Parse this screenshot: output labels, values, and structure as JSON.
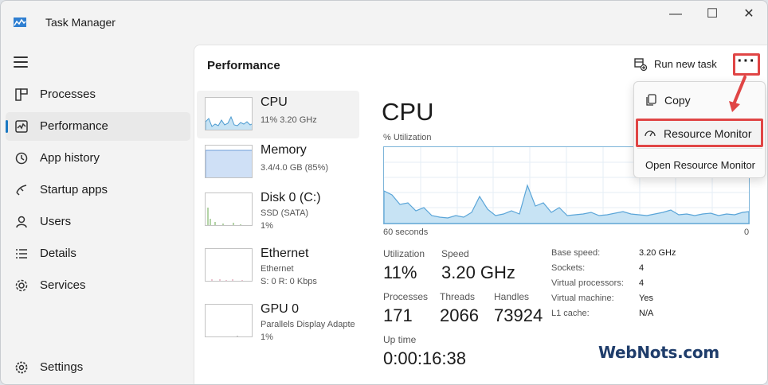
{
  "window": {
    "title": "Task Manager",
    "minimize": "—",
    "maximize": "☐",
    "close": "✕"
  },
  "sidebar": {
    "items": [
      {
        "label": "Processes",
        "icon": "processes-icon"
      },
      {
        "label": "Performance",
        "icon": "performance-icon"
      },
      {
        "label": "App history",
        "icon": "history-icon"
      },
      {
        "label": "Startup apps",
        "icon": "startup-icon"
      },
      {
        "label": "Users",
        "icon": "users-icon"
      },
      {
        "label": "Details",
        "icon": "details-icon"
      },
      {
        "label": "Services",
        "icon": "services-icon"
      }
    ],
    "settings": "Settings",
    "active_index": 1
  },
  "header": {
    "title": "Performance",
    "run_task": "Run new task",
    "more": "···"
  },
  "devices": [
    {
      "name": "CPU",
      "sub1": "11%  3.20 GHz",
      "sub2": ""
    },
    {
      "name": "Memory",
      "sub1": "3.4/4.0 GB (85%)",
      "sub2": ""
    },
    {
      "name": "Disk 0 (C:)",
      "sub1": "SSD (SATA)",
      "sub2": "1%"
    },
    {
      "name": "Ethernet",
      "sub1": "Ethernet",
      "sub2": "S: 0  R: 0 Kbps"
    },
    {
      "name": "GPU 0",
      "sub1": "Parallels Display Adapte",
      "sub2": "1%"
    }
  ],
  "cpu": {
    "title": "CPU",
    "util_label": "% Utilization",
    "axis_left": "60 seconds",
    "axis_right": "0",
    "utilization_label": "Utilization",
    "utilization": "11%",
    "speed_label": "Speed",
    "speed": "3.20 GHz",
    "processes_label": "Processes",
    "processes": "171",
    "threads_label": "Threads",
    "threads": "2066",
    "handles_label": "Handles",
    "handles": "73924",
    "uptime_label": "Up time",
    "uptime": "0:00:16:38",
    "specs": [
      {
        "label": "Base speed:",
        "value": "3.20 GHz"
      },
      {
        "label": "Sockets:",
        "value": "4"
      },
      {
        "label": "Virtual processors:",
        "value": "4"
      },
      {
        "label": "Virtual machine:",
        "value": "Yes"
      },
      {
        "label": "L1 cache:",
        "value": "N/A"
      }
    ]
  },
  "menu": {
    "items": [
      "Copy",
      "Resource Monitor",
      "Open Resource Monitor"
    ]
  },
  "colors": {
    "accent": "#1a78c2",
    "highlight": "#e04545",
    "graph_fill": "#c7e3f4",
    "graph_line": "#7cb4d9"
  },
  "watermark": "WebNots.com"
}
